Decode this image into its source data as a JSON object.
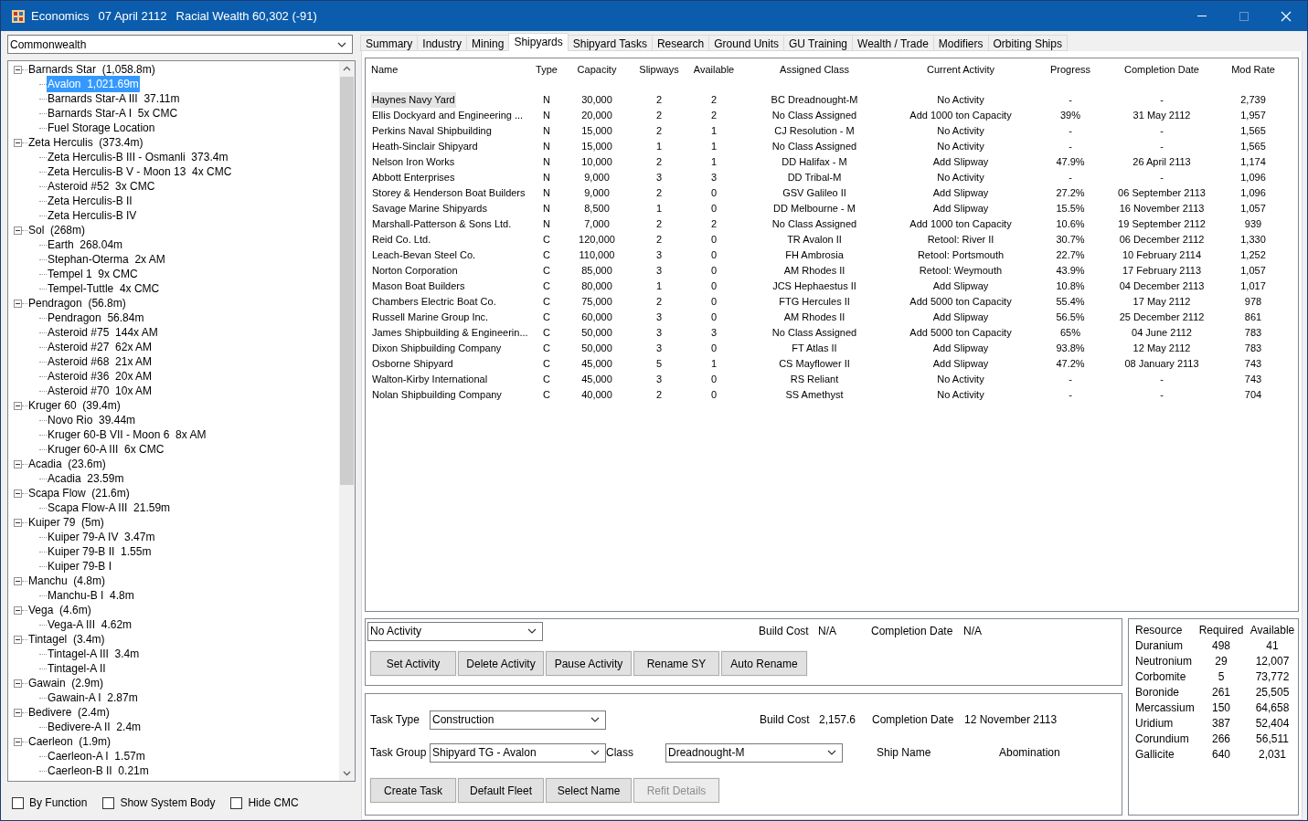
{
  "window": {
    "title": "Economics",
    "date": "07 April 2112",
    "wealth": "Racial Wealth 60,302 (-91)"
  },
  "empire_select": {
    "value": "Commonwealth"
  },
  "tree": [
    {
      "label": "Barnards Star  (1,058.8m)",
      "expanded": true,
      "children": [
        {
          "label": "Avalon  1,021.69m",
          "selected": true
        },
        {
          "label": "Barnards Star-A III  37.11m",
          "selected": false
        },
        {
          "label": "Barnards Star-A I  5x CMC",
          "selected": false
        },
        {
          "label": "Fuel Storage Location",
          "selected": false
        }
      ]
    },
    {
      "label": "Zeta Herculis  (373.4m)",
      "expanded": true,
      "children": [
        {
          "label": "Zeta Herculis-B III - Osmanli  373.4m",
          "selected": false
        },
        {
          "label": "Zeta Herculis-B V - Moon 13  4x CMC",
          "selected": false
        },
        {
          "label": "Asteroid #52  3x CMC",
          "selected": false
        },
        {
          "label": "Zeta Herculis-B II",
          "selected": false
        },
        {
          "label": "Zeta Herculis-B IV",
          "selected": false
        }
      ]
    },
    {
      "label": "Sol  (268m)",
      "expanded": true,
      "children": [
        {
          "label": "Earth  268.04m",
          "selected": false
        },
        {
          "label": "Stephan-Oterma  2x AM",
          "selected": false
        },
        {
          "label": "Tempel 1  9x CMC",
          "selected": false
        },
        {
          "label": "Tempel-Tuttle  4x CMC",
          "selected": false
        }
      ]
    },
    {
      "label": "Pendragon  (56.8m)",
      "expanded": true,
      "children": [
        {
          "label": "Pendragon  56.84m",
          "selected": false
        },
        {
          "label": "Asteroid #75  144x AM",
          "selected": false
        },
        {
          "label": "Asteroid #27  62x AM",
          "selected": false
        },
        {
          "label": "Asteroid #68  21x AM",
          "selected": false
        },
        {
          "label": "Asteroid #36  20x AM",
          "selected": false
        },
        {
          "label": "Asteroid #70  10x AM",
          "selected": false
        }
      ]
    },
    {
      "label": "Kruger 60  (39.4m)",
      "expanded": true,
      "children": [
        {
          "label": "Novo Rio  39.44m",
          "selected": false
        },
        {
          "label": "Kruger 60-B VII - Moon 6  8x AM",
          "selected": false
        },
        {
          "label": "Kruger 60-A III  6x CMC",
          "selected": false
        }
      ]
    },
    {
      "label": "Acadia  (23.6m)",
      "expanded": true,
      "children": [
        {
          "label": "Acadia  23.59m",
          "selected": false
        }
      ]
    },
    {
      "label": "Scapa Flow  (21.6m)",
      "expanded": true,
      "children": [
        {
          "label": "Scapa Flow-A III  21.59m",
          "selected": false
        }
      ]
    },
    {
      "label": "Kuiper 79  (5m)",
      "expanded": true,
      "children": [
        {
          "label": "Kuiper 79-A IV  3.47m",
          "selected": false
        },
        {
          "label": "Kuiper 79-B II  1.55m",
          "selected": false
        },
        {
          "label": "Kuiper 79-B I",
          "selected": false
        }
      ]
    },
    {
      "label": "Manchu  (4.8m)",
      "expanded": true,
      "children": [
        {
          "label": "Manchu-B I  4.8m",
          "selected": false
        }
      ]
    },
    {
      "label": "Vega  (4.6m)",
      "expanded": true,
      "children": [
        {
          "label": "Vega-A III  4.62m",
          "selected": false
        }
      ]
    },
    {
      "label": "Tintagel  (3.4m)",
      "expanded": true,
      "children": [
        {
          "label": "Tintagel-A III  3.4m",
          "selected": false
        },
        {
          "label": "Tintagel-A II",
          "selected": false
        }
      ]
    },
    {
      "label": "Gawain  (2.9m)",
      "expanded": true,
      "children": [
        {
          "label": "Gawain-A I  2.87m",
          "selected": false
        }
      ]
    },
    {
      "label": "Bedivere  (2.4m)",
      "expanded": true,
      "children": [
        {
          "label": "Bedivere-A II  2.4m",
          "selected": false
        }
      ]
    },
    {
      "label": "Caerleon  (1.9m)",
      "expanded": true,
      "children": [
        {
          "label": "Caerleon-A I  1.57m",
          "selected": false
        },
        {
          "label": "Caerleon-B II  0.21m",
          "selected": false
        }
      ]
    }
  ],
  "options": [
    {
      "label": "By Function",
      "checked": false
    },
    {
      "label": "Show System Body",
      "checked": false
    },
    {
      "label": "Hide CMC",
      "checked": false
    }
  ],
  "tabs": [
    {
      "label": "Summary",
      "selected": false
    },
    {
      "label": "Industry",
      "selected": false
    },
    {
      "label": "Mining",
      "selected": false
    },
    {
      "label": "Shipyards",
      "selected": true
    },
    {
      "label": "Shipyard Tasks",
      "selected": false
    },
    {
      "label": "Research",
      "selected": false
    },
    {
      "label": "Ground Units",
      "selected": false
    },
    {
      "label": "GU Training",
      "selected": false
    },
    {
      "label": "Wealth / Trade",
      "selected": false
    },
    {
      "label": "Modifiers",
      "selected": false
    },
    {
      "label": "Orbiting Ships",
      "selected": false
    }
  ],
  "table": {
    "columns": [
      "Name",
      "Type",
      "Capacity",
      "Slipways",
      "Available",
      "Assigned Class",
      "Current Activity",
      "Progress",
      "Completion Date",
      "Mod Rate"
    ],
    "rows": [
      {
        "selected": true,
        "cells": [
          "Haynes Navy Yard",
          "N",
          "30,000",
          "2",
          "2",
          "BC Dreadnought-M",
          "No Activity",
          "-",
          "-",
          "2,739"
        ]
      },
      {
        "selected": false,
        "cells": [
          "Ellis Dockyard and Engineering ...",
          "N",
          "20,000",
          "2",
          "2",
          "No Class Assigned",
          "Add 1000 ton Capacity",
          "39%",
          "31 May 2112",
          "1,957"
        ]
      },
      {
        "selected": false,
        "cells": [
          "Perkins Naval Shipbuilding",
          "N",
          "15,000",
          "2",
          "1",
          "CJ Resolution - M",
          "No Activity",
          "-",
          "-",
          "1,565"
        ]
      },
      {
        "selected": false,
        "cells": [
          "Heath-Sinclair Shipyard",
          "N",
          "15,000",
          "1",
          "1",
          "No Class Assigned",
          "No Activity",
          "-",
          "-",
          "1,565"
        ]
      },
      {
        "selected": false,
        "cells": [
          "Nelson Iron Works",
          "N",
          "10,000",
          "2",
          "1",
          "DD Halifax - M",
          "Add Slipway",
          "47.9%",
          "26 April 2113",
          "1,174"
        ]
      },
      {
        "selected": false,
        "cells": [
          "Abbott Enterprises",
          "N",
          "9,000",
          "3",
          "3",
          "DD Tribal-M",
          "No Activity",
          "-",
          "-",
          "1,096"
        ]
      },
      {
        "selected": false,
        "cells": [
          "Storey & Henderson Boat Builders",
          "N",
          "9,000",
          "2",
          "0",
          "GSV Galileo II",
          "Add Slipway",
          "27.2%",
          "06 September 2113",
          "1,096"
        ]
      },
      {
        "selected": false,
        "cells": [
          "Savage Marine Shipyards",
          "N",
          "8,500",
          "1",
          "0",
          "DD Melbourne - M",
          "Add Slipway",
          "15.5%",
          "16 November 2113",
          "1,057"
        ]
      },
      {
        "selected": false,
        "cells": [
          "Marshall-Patterson & Sons Ltd.",
          "N",
          "7,000",
          "2",
          "2",
          "No Class Assigned",
          "Add 1000 ton Capacity",
          "10.6%",
          "19 September 2112",
          "939"
        ]
      },
      {
        "selected": false,
        "cells": [
          "Reid Co. Ltd.",
          "C",
          "120,000",
          "2",
          "0",
          "TR Avalon II",
          "Retool: River II",
          "30.7%",
          "06 December 2112",
          "1,330"
        ]
      },
      {
        "selected": false,
        "cells": [
          "Leach-Bevan Steel Co.",
          "C",
          "110,000",
          "3",
          "0",
          "FH Ambrosia",
          "Retool: Portsmouth",
          "22.7%",
          "10 February 2114",
          "1,252"
        ]
      },
      {
        "selected": false,
        "cells": [
          "Norton Corporation",
          "C",
          "85,000",
          "3",
          "0",
          "AM Rhodes II",
          "Retool: Weymouth",
          "43.9%",
          "17 February 2113",
          "1,057"
        ]
      },
      {
        "selected": false,
        "cells": [
          "Mason Boat Builders",
          "C",
          "80,000",
          "1",
          "0",
          "JCS Hephaestus II",
          "Add Slipway",
          "10.8%",
          "04 December 2113",
          "1,017"
        ]
      },
      {
        "selected": false,
        "cells": [
          "Chambers Electric Boat Co.",
          "C",
          "75,000",
          "2",
          "0",
          "FTG Hercules II",
          "Add 5000 ton Capacity",
          "55.4%",
          "17 May 2112",
          "978"
        ]
      },
      {
        "selected": false,
        "cells": [
          "Russell Marine Group Inc.",
          "C",
          "60,000",
          "3",
          "0",
          "AM Rhodes II",
          "Add Slipway",
          "56.5%",
          "25 December 2112",
          "861"
        ]
      },
      {
        "selected": false,
        "cells": [
          "James Shipbuilding & Engineerin...",
          "C",
          "50,000",
          "3",
          "3",
          "No Class Assigned",
          "Add 5000 ton Capacity",
          "65%",
          "04 June 2112",
          "783"
        ]
      },
      {
        "selected": false,
        "cells": [
          "Dixon Shipbuilding Company",
          "C",
          "50,000",
          "3",
          "0",
          "FT Atlas II",
          "Add Slipway",
          "93.8%",
          "12 May 2112",
          "783"
        ]
      },
      {
        "selected": false,
        "cells": [
          "Osborne Shipyard",
          "C",
          "45,000",
          "5",
          "1",
          "CS Mayflower II",
          "Add Slipway",
          "47.2%",
          "08 January 2113",
          "743"
        ]
      },
      {
        "selected": false,
        "cells": [
          "Walton-Kirby International",
          "C",
          "45,000",
          "3",
          "0",
          "RS Reliant",
          "No Activity",
          "-",
          "-",
          "743"
        ]
      },
      {
        "selected": false,
        "cells": [
          "Nolan Shipbuilding Company",
          "C",
          "40,000",
          "2",
          "0",
          "SS Amethyst",
          "No Activity",
          "-",
          "-",
          "704"
        ]
      }
    ]
  },
  "activity_panel": {
    "activity_select": "No Activity",
    "build_cost_label": "Build Cost",
    "build_cost": "N/A",
    "completion_label": "Completion Date",
    "completion": "N/A",
    "buttons": [
      {
        "label": "Set Activity",
        "disabled": false
      },
      {
        "label": "Delete Activity",
        "disabled": false
      },
      {
        "label": "Pause Activity",
        "disabled": false
      },
      {
        "label": "Rename SY",
        "disabled": false
      },
      {
        "label": "Auto Rename",
        "disabled": false
      }
    ]
  },
  "task_panel": {
    "task_type_label": "Task Type",
    "task_type": "Construction",
    "build_cost_label": "Build Cost",
    "build_cost": "2,157.6",
    "completion_label": "Completion Date",
    "completion": "12 November 2113",
    "task_group_label": "Task Group",
    "task_group": "Shipyard TG - Avalon",
    "class_label": "Class",
    "class": "Dreadnought-M",
    "ship_name_label": "Ship Name",
    "ship_name": "Abomination",
    "buttons": [
      {
        "label": "Create Task",
        "disabled": false
      },
      {
        "label": "Default Fleet",
        "disabled": false
      },
      {
        "label": "Select Name",
        "disabled": false
      },
      {
        "label": "Refit Details",
        "disabled": true
      }
    ]
  },
  "resources": {
    "columns": [
      "Resource",
      "Required",
      "Available"
    ],
    "rows": [
      [
        "Duranium",
        "498",
        "41"
      ],
      [
        "Neutronium",
        "29",
        "12,007"
      ],
      [
        "Corbomite",
        "5",
        "73,772"
      ],
      [
        "Boronide",
        "261",
        "25,505"
      ],
      [
        "Mercassium",
        "150",
        "64,658"
      ],
      [
        "Uridium",
        "387",
        "52,404"
      ],
      [
        "Corundium",
        "266",
        "56,511"
      ],
      [
        "Gallicite",
        "640",
        "2,031"
      ]
    ]
  }
}
